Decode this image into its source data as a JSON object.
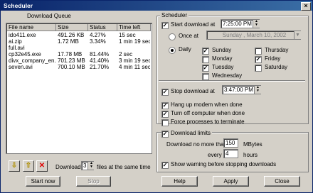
{
  "window": {
    "title": "Scheduler"
  },
  "queue": {
    "label": "Download Queue",
    "columns": [
      "File name",
      "Size",
      "Status",
      "Time left"
    ],
    "rows": [
      {
        "name": "ido411.exe",
        "size": "491.26  KB",
        "status": "4.27%",
        "time": "15 sec"
      },
      {
        "name": "ai.zip",
        "size": "1.72  MB",
        "status": "3.34%",
        "time": "1 min 19 sec"
      },
      {
        "name": "full.avi",
        "size": "",
        "status": "",
        "time": ""
      },
      {
        "name": "cp32e45.exe",
        "size": "17.78  MB",
        "status": "81.44%",
        "time": "2 sec"
      },
      {
        "name": "divx_company_en...",
        "size": "701.23  MB",
        "status": "41.40%",
        "time": "3 min 19 sec"
      },
      {
        "name": "seven.avi",
        "size": "700.10  MB",
        "status": "21.70%",
        "time": "4 min 11 sec"
      }
    ],
    "download_label": "Download",
    "download_value": "3",
    "files_label": "files at the same time",
    "move_down_icon": "arrow-down-icon",
    "move_up_icon": "arrow-up-icon",
    "delete_icon": "red-x-icon",
    "accent_colors": {
      "arrow": "#d8c020",
      "delete": "#e00000"
    }
  },
  "scheduler": {
    "label": "Scheduler",
    "start_download_label": "Start download at",
    "start_time": "7:25:00 PM",
    "once_label": "Once at",
    "once_date": "Sunday  ,  March  10, 2002",
    "daily_label": "Daily",
    "days": [
      {
        "label": "Sunday",
        "checked": true
      },
      {
        "label": "Monday",
        "checked": false
      },
      {
        "label": "Tuesday",
        "checked": true
      },
      {
        "label": "Wednesday",
        "checked": false
      },
      {
        "label": "Thursday",
        "checked": false
      },
      {
        "label": "Friday",
        "checked": true
      },
      {
        "label": "Saturday",
        "checked": false
      }
    ],
    "stop_download_label": "Stop download at",
    "stop_time": "3:47:00 PM",
    "hangup_label": "Hang up modem when done",
    "turnoff_label": "Turn off computer when done",
    "force_label": "Force processes to terminate"
  },
  "limits": {
    "label": "Download limits",
    "no_more_label": "Download no more than",
    "mb_value": "150",
    "mb_unit": "MBytes",
    "every_label": "every",
    "hours_value": "4",
    "hours_unit": "hours",
    "warning_label": "Show warning before stopping downloads"
  },
  "buttons": {
    "start_now": "Start now",
    "stop": "Stop",
    "help": "Help",
    "apply": "Apply",
    "close": "Close"
  }
}
